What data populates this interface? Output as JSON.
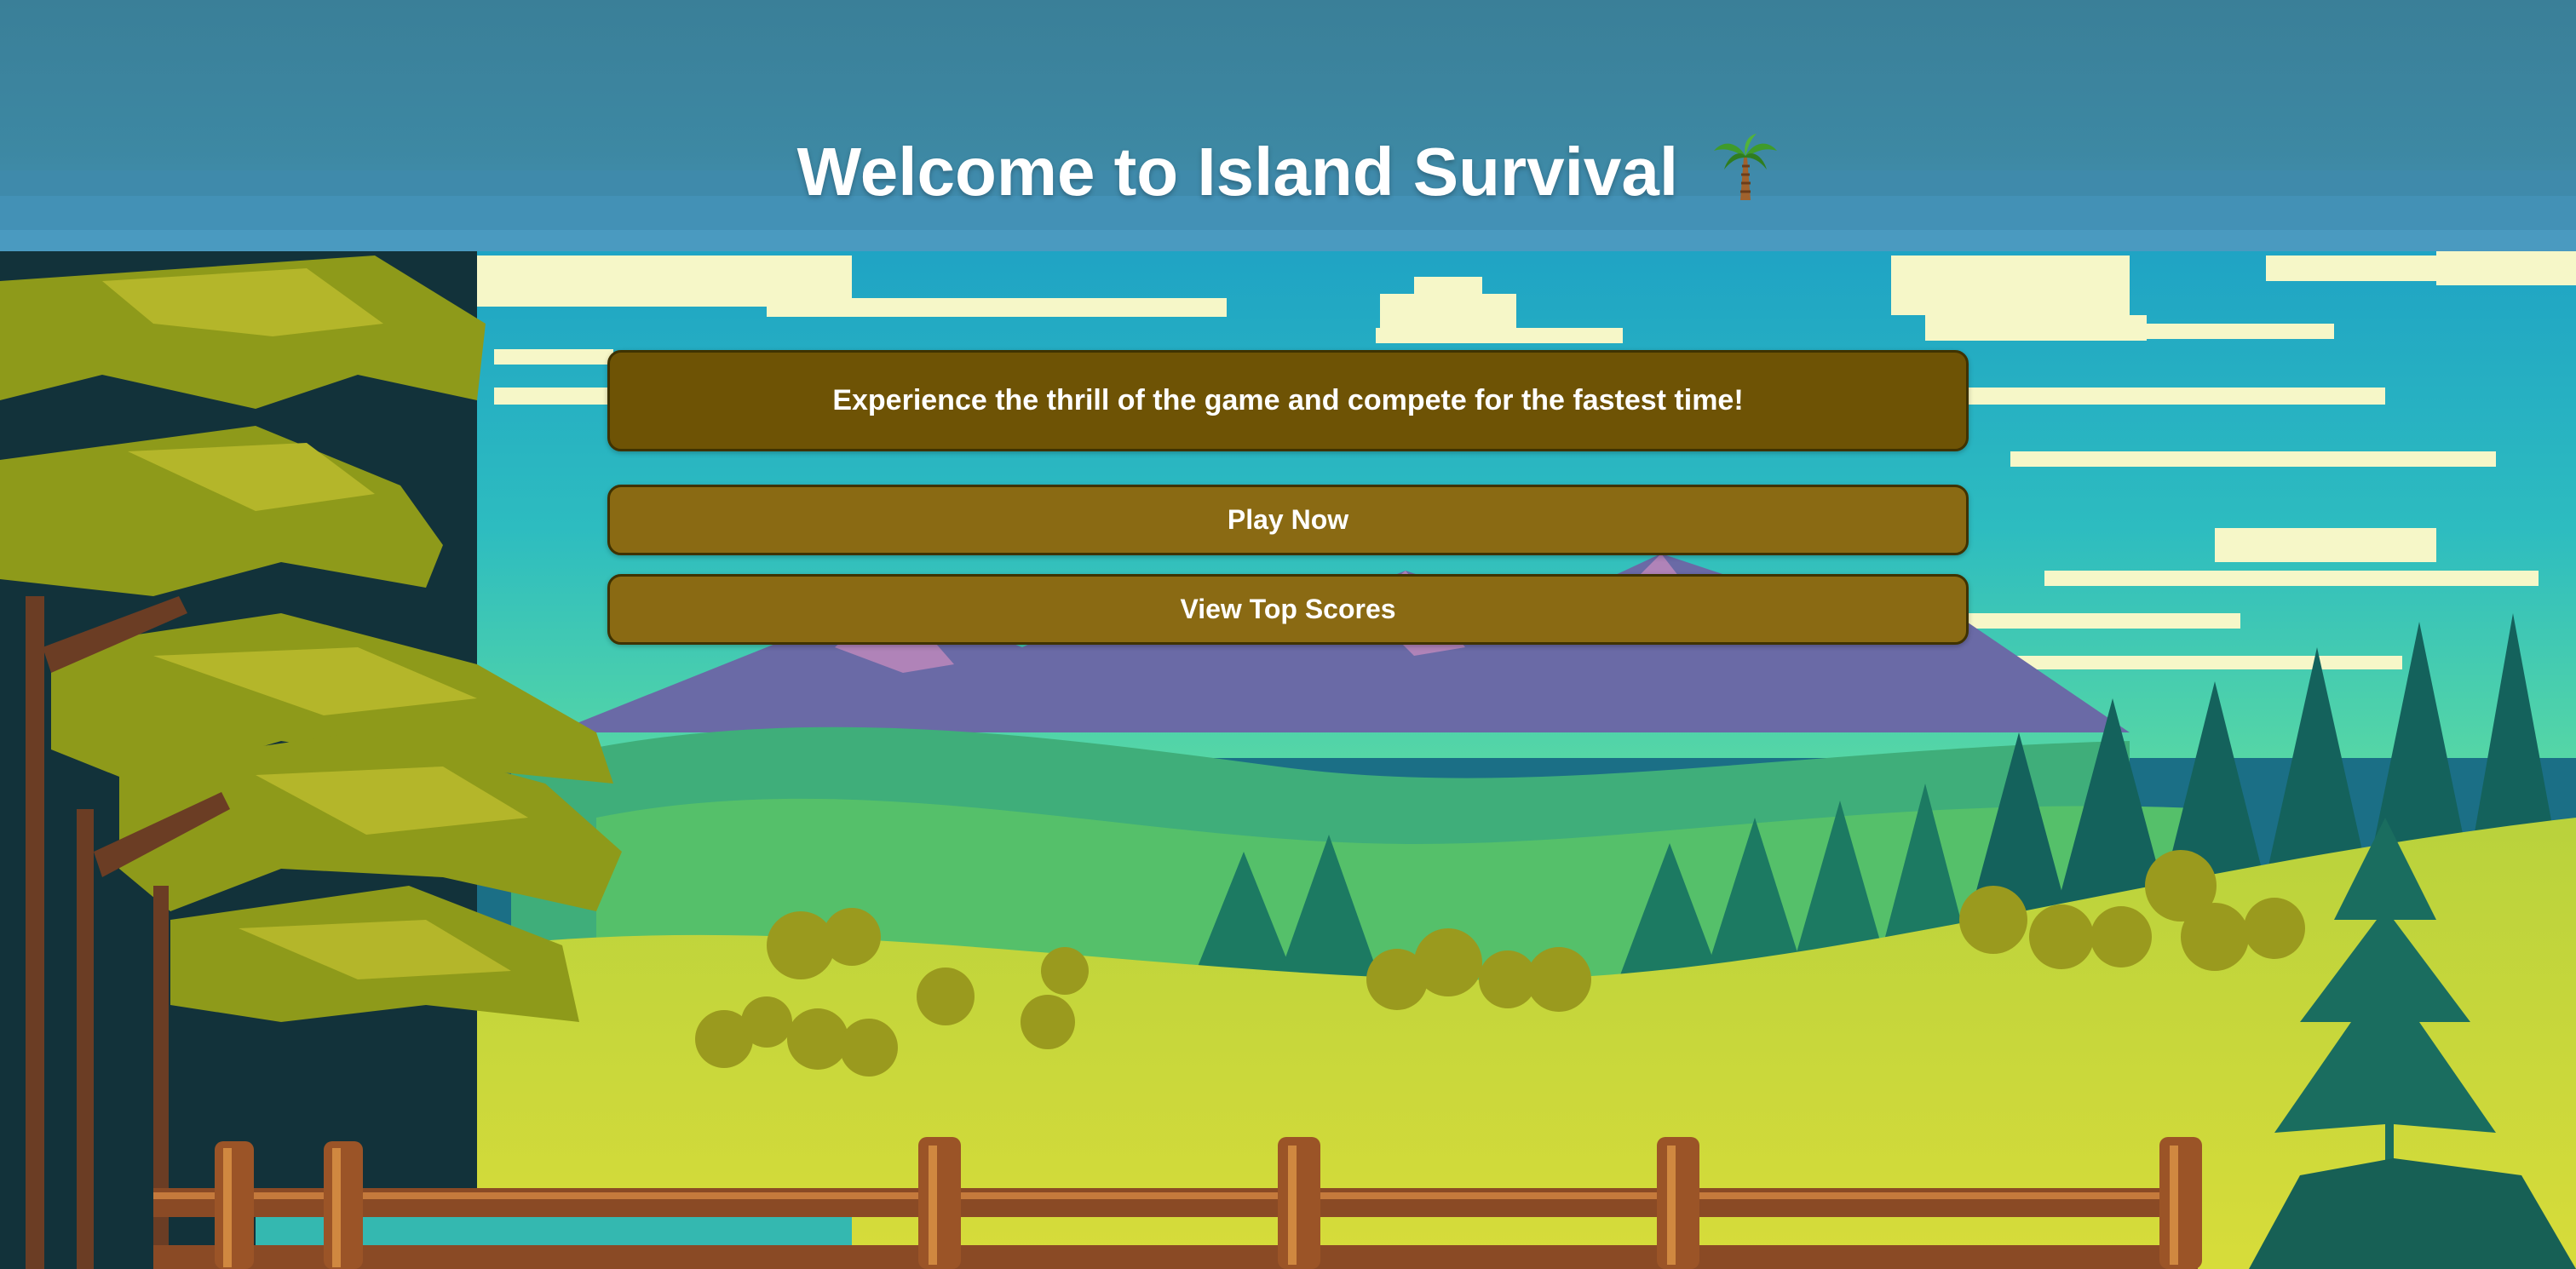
{
  "header": {
    "title": "Welcome to Island Survival",
    "title_icon": "palm-tree-icon"
  },
  "intro": {
    "tagline": "Experience the thrill of the game and compete for the fastest time!"
  },
  "menu": {
    "play_label": "Play Now",
    "scores_label": "View Top Scores"
  },
  "colors": {
    "header_bg": "#3d88a3",
    "panel_bg": "#6e5305",
    "button_bg": "#8a6a13",
    "panel_border": "#3f3200",
    "text": "#ffffff"
  }
}
